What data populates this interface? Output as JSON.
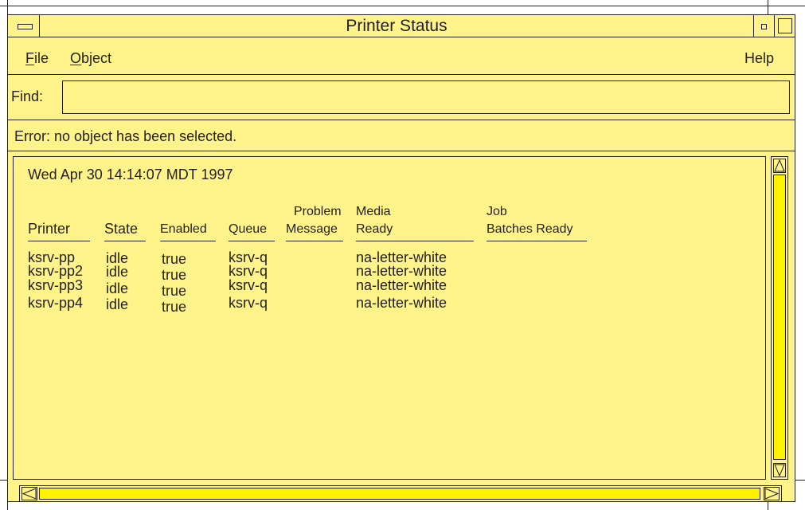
{
  "window": {
    "title": "Printer Status"
  },
  "menubar": {
    "file": {
      "mnemonic": "F",
      "rest": "ile"
    },
    "object": {
      "mnemonic": "O",
      "rest": "bject"
    },
    "help": "Help"
  },
  "find": {
    "label": "Find:",
    "value": ""
  },
  "status": {
    "message": "Error:  no object has been selected."
  },
  "content": {
    "timestamp": "Wed Apr 30 14:14:07 MDT 1997",
    "columns": {
      "printer": "Printer",
      "state": "State",
      "enabled": "Enabled",
      "queue": "Queue",
      "problem_line1": "Problem",
      "problem_line2": "Message",
      "media_line1": "Media",
      "media_line2": "Ready",
      "job_line1": "Job",
      "job_line2": "Batches Ready"
    },
    "rows": [
      {
        "printer": "ksrv-pp",
        "state": "idle",
        "enabled": "true",
        "queue": "ksrv-q",
        "problem": "",
        "media": "na-letter-white",
        "job": ""
      },
      {
        "printer": "ksrv-pp2",
        "state": "idle",
        "enabled": "true",
        "queue": "ksrv-q",
        "problem": "",
        "media": "na-letter-white",
        "job": ""
      },
      {
        "printer": "ksrv-pp3",
        "state": "idle",
        "enabled": "true",
        "queue": "ksrv-q",
        "problem": "",
        "media": "na-letter-white",
        "job": ""
      },
      {
        "printer": "ksrv-pp4",
        "state": "idle",
        "enabled": "true",
        "queue": "ksrv-q",
        "problem": "",
        "media": "na-letter-white",
        "job": ""
      }
    ]
  },
  "icons": {
    "window_menu": "window-menu-icon",
    "minimize": "minimize-icon",
    "maximize": "maximize-icon",
    "scroll_up": "arrow-up-icon",
    "scroll_down": "arrow-down-icon",
    "scroll_left": "arrow-left-icon",
    "scroll_right": "arrow-right-icon"
  },
  "colors": {
    "window_bg": "#fff38a",
    "thumb": "#fff200",
    "ink": "#231f20"
  }
}
